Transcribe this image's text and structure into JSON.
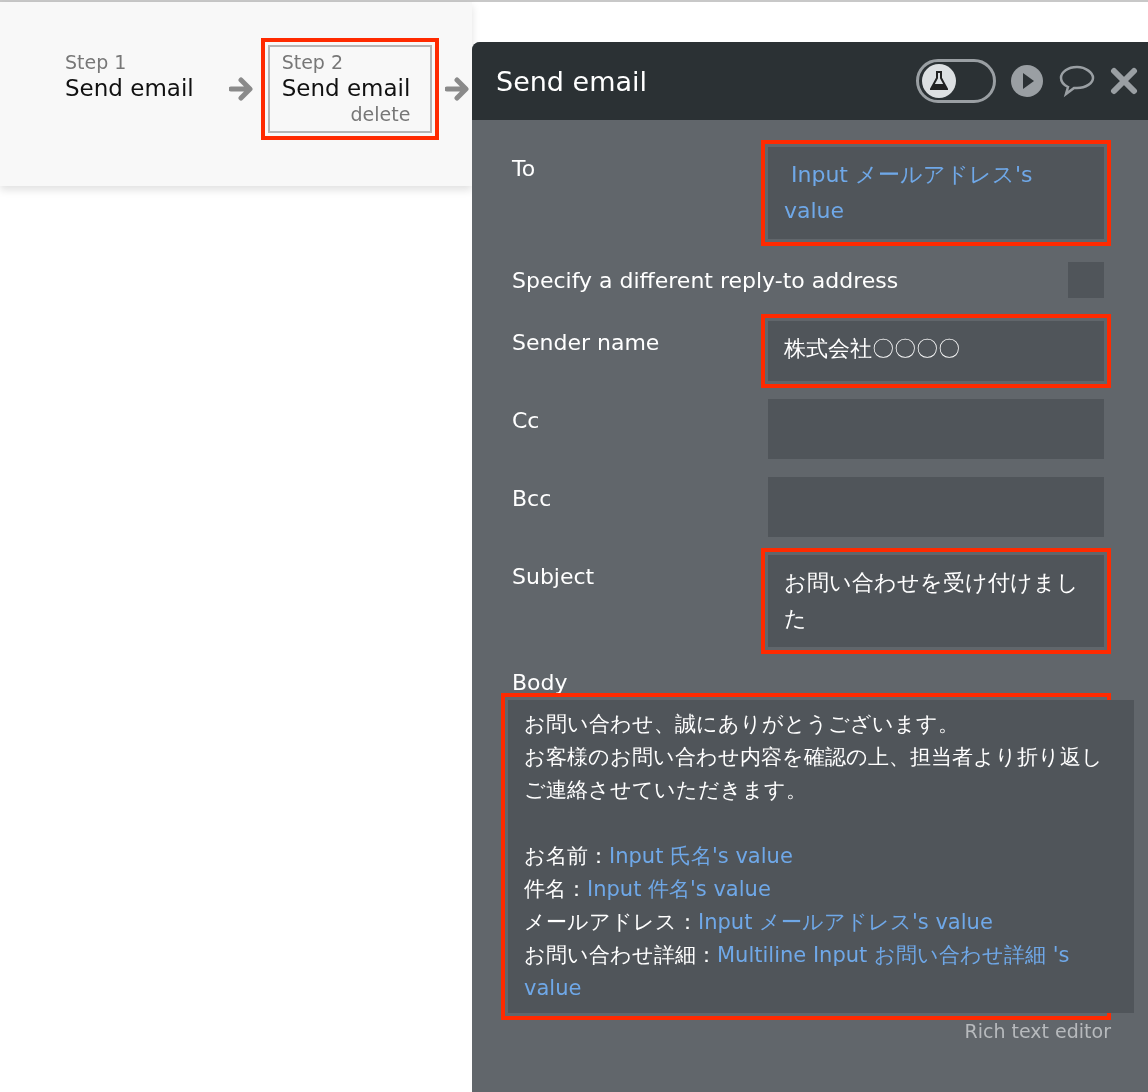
{
  "steps": [
    {
      "caption": "Step 1",
      "title": "Send email",
      "selected": false,
      "highlighted": false
    },
    {
      "caption": "Step 2",
      "title": "Send email",
      "delete_label": "delete",
      "selected": true,
      "highlighted": true
    }
  ],
  "panel": {
    "title": "Send email",
    "test_mode": false,
    "fields": [
      {
        "kind": "text",
        "label": "To",
        "value": " Input メールアドレス's value",
        "dynamic": true,
        "highlighted": true
      },
      {
        "kind": "checkbox",
        "label": "Specify a different reply-to address",
        "checked": false,
        "highlighted": false
      },
      {
        "kind": "text",
        "label": "Sender name",
        "value": "株式会社〇〇〇〇",
        "dynamic": false,
        "highlighted": true
      },
      {
        "kind": "text",
        "label": "Cc",
        "highlighted": false
      },
      {
        "kind": "text",
        "label": "Bcc",
        "highlighted": false
      },
      {
        "kind": "text",
        "label": "Subject",
        "value": "お問い合わせを受け付けました",
        "dynamic": false,
        "highlighted": true
      }
    ],
    "body": {
      "label": "Body",
      "highlighted": true,
      "editor_note": "Rich text editor",
      "lines": [
        {
          "kind": "text",
          "segments": [
            {
              "text": "お問い合わせ、誠にありがとうございます。",
              "dynamic": false
            }
          ]
        },
        {
          "kind": "text",
          "segments": [
            {
              "text": "お客様のお問い合わせ内容を確認の上、担当者より折り返しご連絡させていただきます。",
              "dynamic": false
            }
          ]
        },
        {
          "kind": "blank"
        },
        {
          "kind": "text",
          "segments": [
            {
              "text": "お名前：",
              "dynamic": false
            },
            {
              "text": "Input 氏名's value",
              "dynamic": true
            }
          ]
        },
        {
          "kind": "text",
          "segments": [
            {
              "text": "件名：",
              "dynamic": false
            },
            {
              "text": "Input 件名's value",
              "dynamic": true
            }
          ]
        },
        {
          "kind": "text",
          "segments": [
            {
              "text": "メールアドレス：",
              "dynamic": false
            },
            {
              "text": "Input メールアドレス's value",
              "dynamic": true
            }
          ]
        },
        {
          "kind": "text",
          "segments": [
            {
              "text": "お問い合わせ詳細：",
              "dynamic": false
            },
            {
              "text": "Multiline Input お問い合わせ詳細 's value",
              "dynamic": true
            }
          ]
        }
      ]
    }
  }
}
